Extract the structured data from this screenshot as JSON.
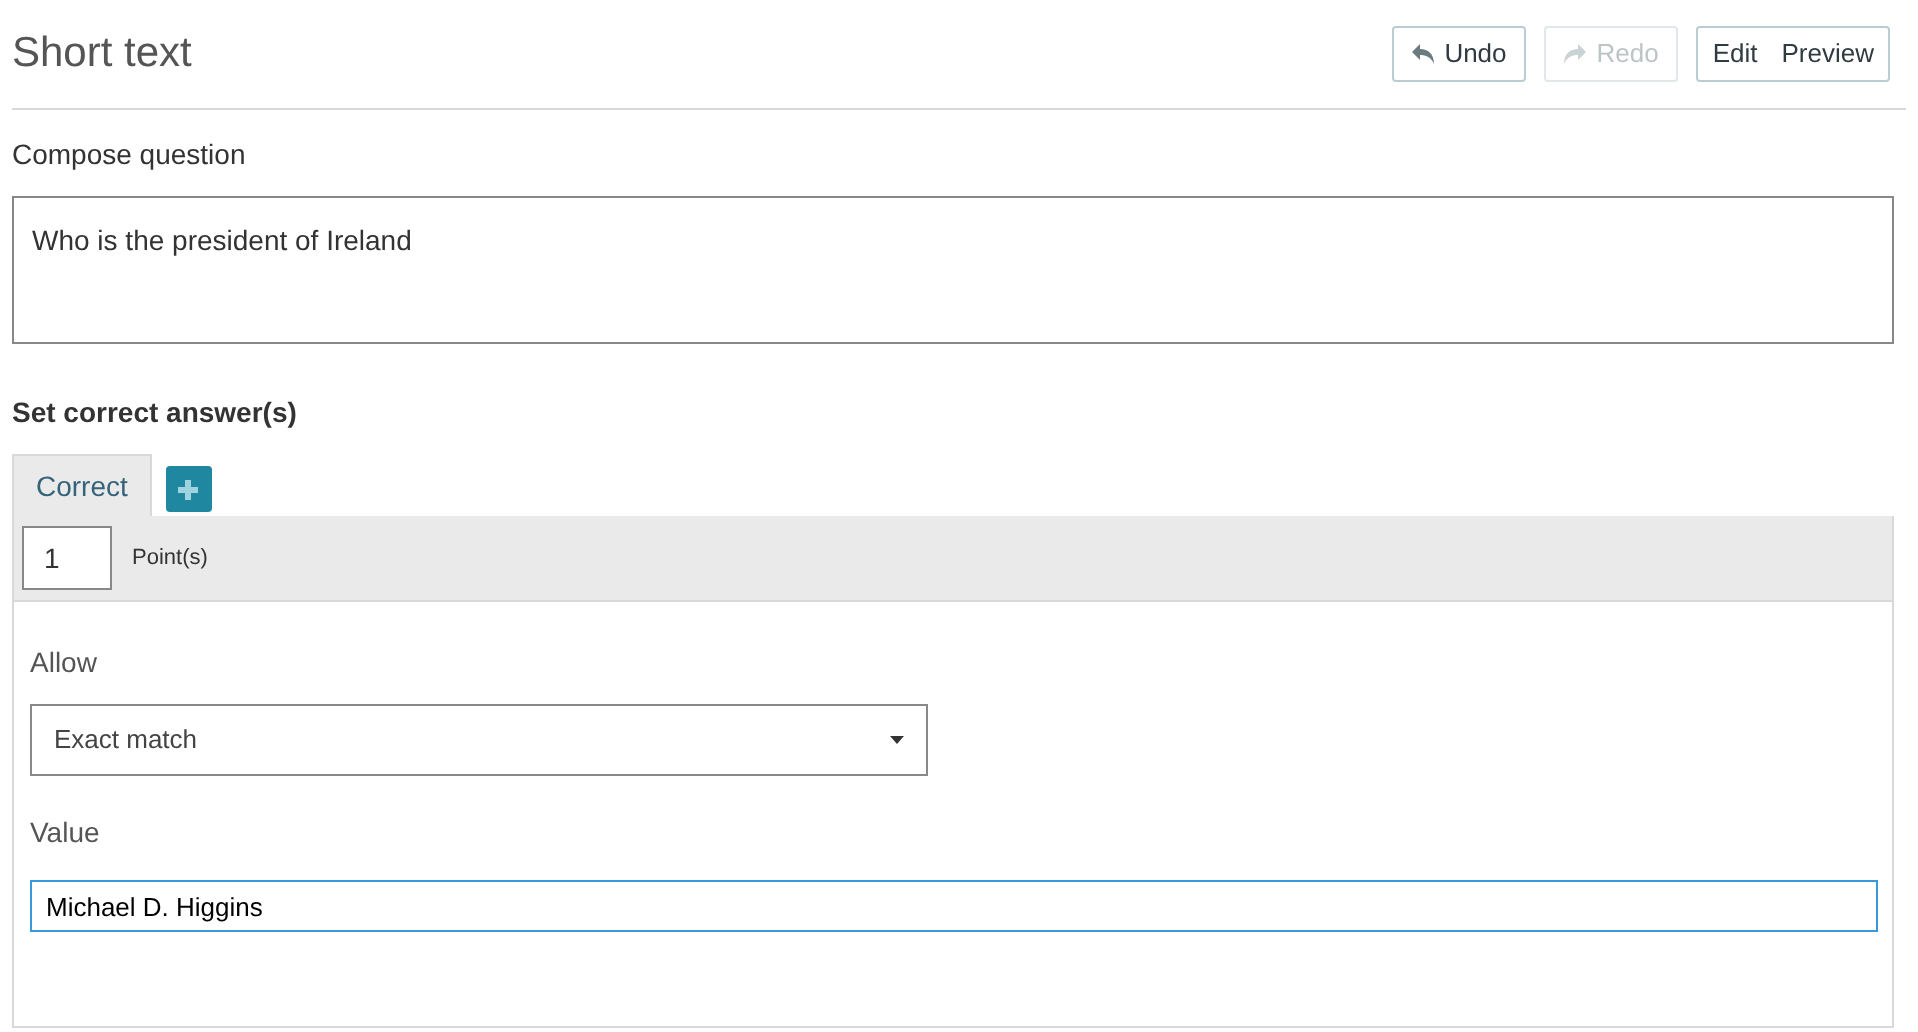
{
  "header": {
    "title": "Short text",
    "buttons": [
      {
        "kind": "undo",
        "label": "Undo",
        "disabled": false
      },
      {
        "kind": "redo",
        "label": "Redo",
        "disabled": true
      }
    ],
    "mode_buttons": [
      {
        "label": "Edit"
      },
      {
        "label": "Preview"
      }
    ]
  },
  "compose": {
    "label": "Compose question",
    "value": "Who is the president of Ireland"
  },
  "answers": {
    "heading": "Set correct answer(s)",
    "tabs": [
      {
        "label": "Correct",
        "selected": true
      }
    ],
    "points": {
      "value": "1",
      "label": "Point(s)"
    },
    "allow": {
      "label": "Allow",
      "value": "Exact match"
    },
    "value_field": {
      "label": "Value",
      "value": "Michael D. Higgins",
      "focused": true
    }
  }
}
